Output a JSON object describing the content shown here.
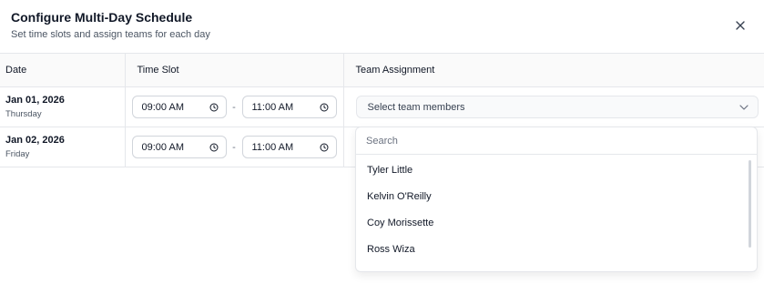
{
  "dialog": {
    "title": "Configure Multi-Day Schedule",
    "subtitle": "Set time slots and assign teams for each day",
    "close_icon": "close-icon"
  },
  "table": {
    "headers": [
      "Date",
      "Time Slot",
      "Team Assignment"
    ],
    "rows": [
      {
        "date": "Jan 01, 2026",
        "weekday": "Thursday",
        "start": "09:00 AM",
        "end": "11:00 AM",
        "separator": "-",
        "team_placeholder": "Select team members"
      },
      {
        "date": "Jan 02, 2026",
        "weekday": "Friday",
        "start": "09:00 AM",
        "end": "11:00 AM",
        "separator": "-"
      }
    ]
  },
  "dropdown": {
    "search_placeholder": "Search",
    "options": [
      "Tyler Little",
      "Kelvin O'Reilly",
      "Coy Morissette",
      "Ross Wiza"
    ]
  }
}
